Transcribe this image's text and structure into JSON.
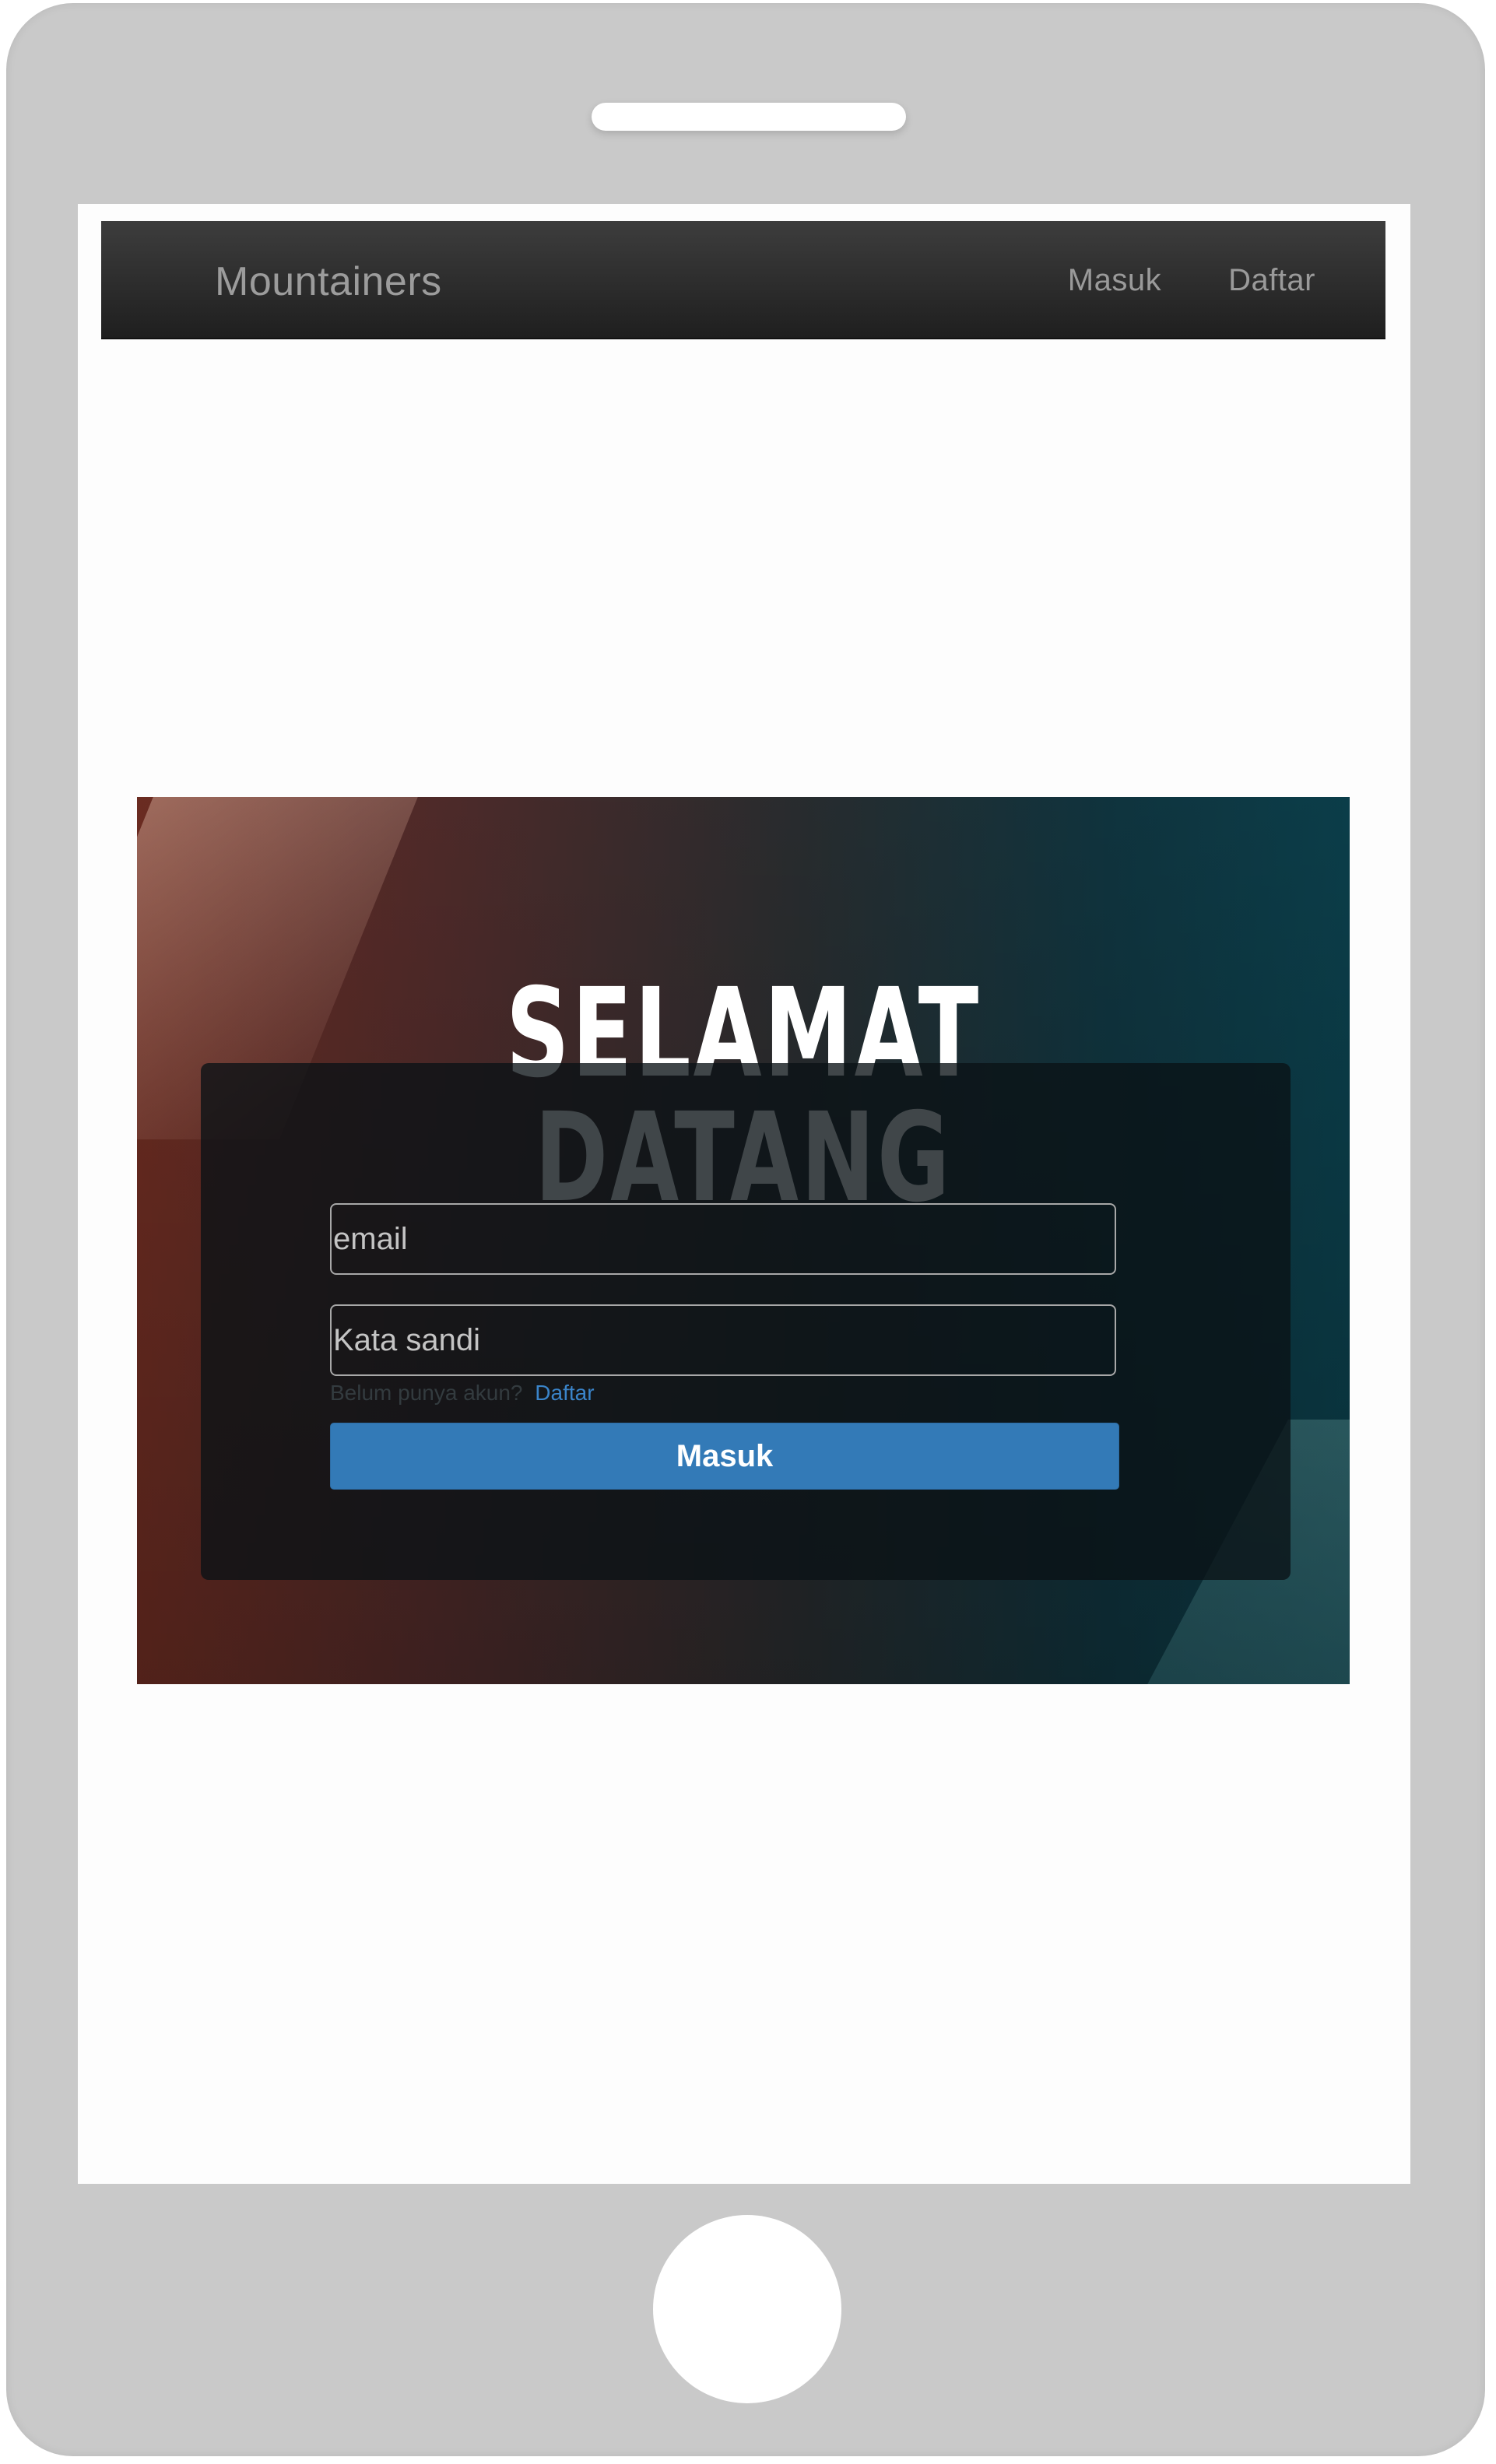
{
  "navbar": {
    "brand": "Mountainers",
    "links": [
      "Masuk",
      "Daftar"
    ]
  },
  "hero": {
    "title": "SELAMAT DATANG"
  },
  "login_form": {
    "email_placeholder": "email",
    "password_placeholder": "Kata sandi",
    "signup_prompt": "Belum punya akun?",
    "signup_link": "Daftar",
    "submit_label": "Masuk"
  },
  "colors": {
    "navbar_bg": "#2b2b2b",
    "primary_button": "#337ab7",
    "link": "#3a84c9",
    "phone_frame": "#c9c9c9"
  }
}
